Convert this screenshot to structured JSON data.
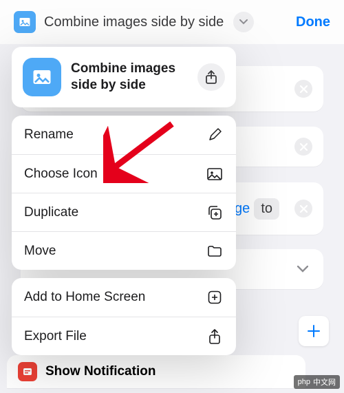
{
  "toolbar": {
    "title": "Combine images side by side",
    "done_label": "Done"
  },
  "popover": {
    "header_title": "Combine images side by side",
    "groups": [
      {
        "items": [
          {
            "key": "rename",
            "label": "Rename",
            "icon": "pencil"
          },
          {
            "key": "choose-icon",
            "label": "Choose Icon",
            "icon": "image"
          },
          {
            "key": "duplicate",
            "label": "Duplicate",
            "icon": "duplicate"
          },
          {
            "key": "move",
            "label": "Move",
            "icon": "folder"
          }
        ]
      },
      {
        "items": [
          {
            "key": "add-home",
            "label": "Add to Home Screen",
            "icon": "plus-square"
          },
          {
            "key": "export",
            "label": "Export File",
            "icon": "share-up"
          }
        ]
      }
    ]
  },
  "background": {
    "row3_link": "age",
    "row3_to": "to"
  },
  "bottom": {
    "label": "Show Notification"
  },
  "watermark": "中文网"
}
